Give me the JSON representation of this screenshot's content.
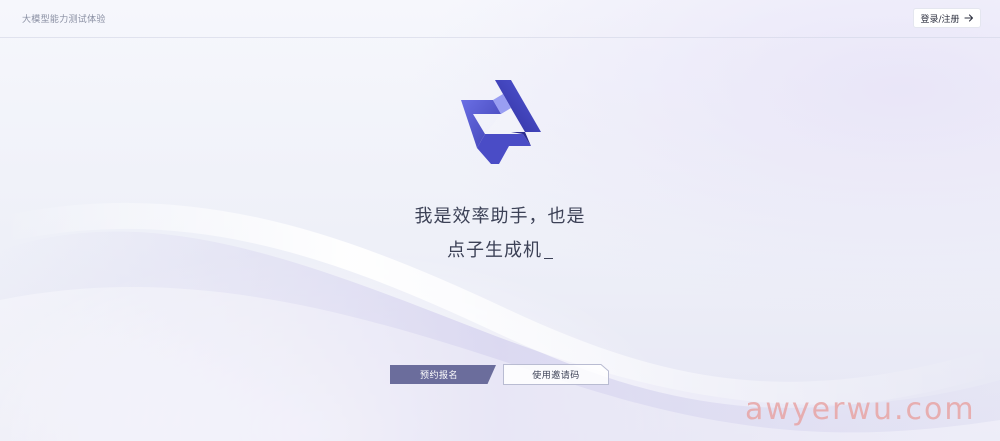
{
  "header": {
    "app_title": "大模型能力测试体验",
    "login_label": "登录/注册",
    "login_icon": "arrow-right-icon"
  },
  "hero": {
    "logo_icon": "star-logo-icon",
    "headline_line1": "我是效率助手，也是",
    "headline_line2": "点子生成机"
  },
  "actions": {
    "reserve_label": "预约报名",
    "invite_label": "使用邀请码"
  },
  "watermark": {
    "text": "awyerwu.com"
  },
  "colors": {
    "brand_primary": "#5b5fd6",
    "brand_dark": "#3e3fb0",
    "button_primary": "#6b6d9c",
    "watermark": "#e8a5a5"
  }
}
